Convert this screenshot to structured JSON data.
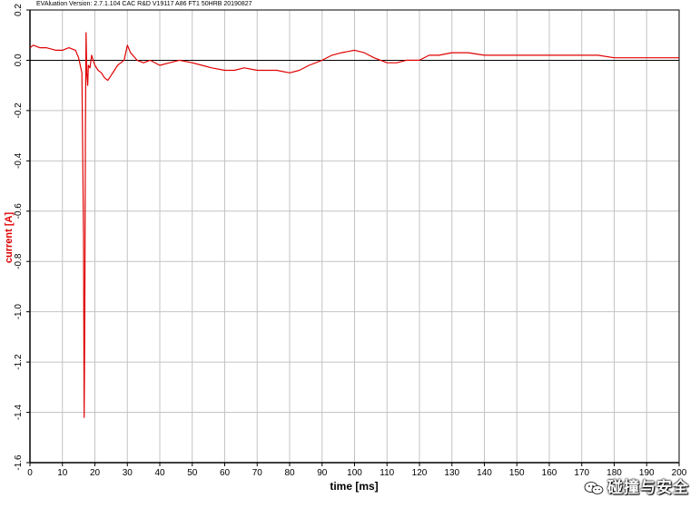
{
  "header_text": "EVAluation Version: 2.7.1.104 CAC R&D V19117 A86 FT1 50HRB 20190827",
  "watermark": {
    "text": "碰撞与安全",
    "icon": "wechat-icon"
  },
  "colors": {
    "series": "#e00000",
    "grid": "#c4c4c4",
    "axis": "#000000",
    "ylabel": "#e00000"
  },
  "chart_data": {
    "type": "line",
    "title": "",
    "xlabel": "time [ms]",
    "ylabel": "current [A]",
    "xlim": [
      0,
      200
    ],
    "ylim": [
      -1.6,
      0.2
    ],
    "x_ticks": [
      0,
      10,
      20,
      30,
      40,
      50,
      60,
      70,
      80,
      90,
      100,
      110,
      120,
      130,
      140,
      150,
      160,
      170,
      180,
      190,
      200
    ],
    "x_tick_labels": [
      "0",
      "10",
      "20",
      "30",
      "40",
      "50",
      "60",
      "70",
      "80",
      "90",
      "100",
      "110",
      "120",
      "130",
      "140",
      "150",
      "160",
      "170",
      "180",
      "190",
      "200"
    ],
    "y_ticks": [
      0.2,
      0.0,
      -0.2,
      -0.4,
      -0.6,
      -0.8,
      -1.0,
      -1.2,
      -1.4,
      -1.6
    ],
    "y_tick_labels": [
      "0.2",
      "0.0",
      "-0.2",
      "-0.4",
      "-0.6",
      "-0.8",
      "-1.0",
      "-1.2",
      "-1.4",
      "-1.6"
    ],
    "grid": true,
    "zero_line": true,
    "series": [
      {
        "x": [
          0,
          1,
          3,
          5,
          8,
          10,
          12,
          14,
          15,
          16,
          16.5,
          16.7,
          16.9,
          17.1,
          17.3,
          17.5,
          17.8,
          18,
          18.5,
          19,
          20,
          21,
          22,
          23,
          24,
          25,
          26,
          27,
          28,
          29,
          30,
          31,
          33,
          35,
          37,
          40,
          43,
          46,
          50,
          53,
          56,
          60,
          63,
          66,
          70,
          73,
          76,
          80,
          83,
          86,
          90,
          93,
          96,
          100,
          103,
          106,
          110,
          113,
          116,
          120,
          123,
          126,
          130,
          135,
          140,
          145,
          150,
          155,
          160,
          165,
          170,
          175,
          180,
          185,
          190,
          195,
          200
        ],
        "y": [
          0.05,
          0.06,
          0.05,
          0.05,
          0.04,
          0.04,
          0.05,
          0.04,
          0.01,
          -0.05,
          -0.7,
          -1.42,
          -1.03,
          -0.27,
          0.11,
          -0.05,
          -0.1,
          -0.02,
          -0.03,
          0.02,
          -0.02,
          -0.04,
          -0.05,
          -0.07,
          -0.08,
          -0.06,
          -0.04,
          -0.02,
          -0.01,
          0.0,
          0.06,
          0.03,
          0.0,
          -0.01,
          0.0,
          -0.02,
          -0.01,
          0.0,
          -0.01,
          -0.02,
          -0.03,
          -0.04,
          -0.04,
          -0.03,
          -0.04,
          -0.04,
          -0.04,
          -0.05,
          -0.04,
          -0.02,
          0.0,
          0.02,
          0.03,
          0.04,
          0.03,
          0.01,
          -0.01,
          -0.01,
          0.0,
          0.0,
          0.02,
          0.02,
          0.03,
          0.03,
          0.02,
          0.02,
          0.02,
          0.02,
          0.02,
          0.02,
          0.02,
          0.02,
          0.01,
          0.01,
          0.01,
          0.01,
          0.01
        ]
      }
    ]
  }
}
